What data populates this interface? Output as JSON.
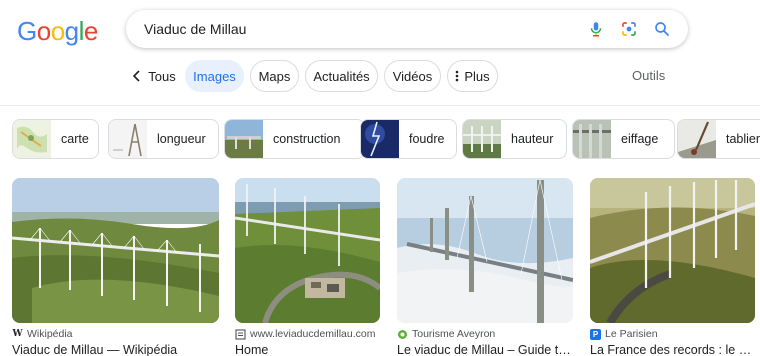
{
  "logo": {
    "letters": [
      "G",
      "o",
      "o",
      "g",
      "l",
      "e"
    ],
    "colors": [
      "#4285f4",
      "#ea4335",
      "#fbbc05",
      "#4285f4",
      "#34a853",
      "#ea4335"
    ]
  },
  "search": {
    "query": "Viaduc de Millau",
    "mic_icon": "mic-icon",
    "lens_icon": "lens-icon",
    "search_icon": "search-icon"
  },
  "tabs": {
    "back_label": "Tous",
    "items": [
      {
        "label": "Images",
        "active": true
      },
      {
        "label": "Maps"
      },
      {
        "label": "Actualités"
      },
      {
        "label": "Vidéos"
      },
      {
        "label": "Plus"
      }
    ],
    "tools_label": "Outils"
  },
  "chips": [
    {
      "label": "carte"
    },
    {
      "label": "longueur"
    },
    {
      "label": "construction"
    },
    {
      "label": "foudre"
    },
    {
      "label": "hauteur"
    },
    {
      "label": "eiffage"
    },
    {
      "label": "tablier"
    }
  ],
  "results": [
    {
      "source": "Wikipédia",
      "title": "Viaduc de Millau — Wikipédia"
    },
    {
      "source": "www.leviaducdemillau.com",
      "title": "Home"
    },
    {
      "source": "Tourisme Aveyron",
      "title": "Le viaduc de Millau – Guide to..."
    },
    {
      "source": "Le Parisien",
      "title": "La France des records : le via..."
    }
  ],
  "colors": {
    "accent": "#1a73e8",
    "active_tab_bg": "#e8f0fe"
  }
}
